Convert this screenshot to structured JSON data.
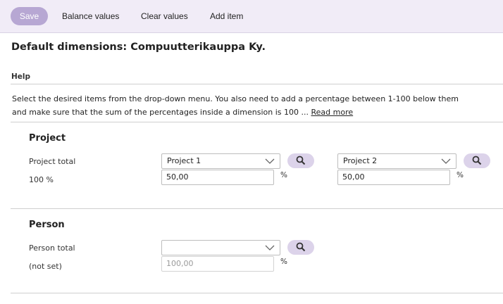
{
  "toolbar": {
    "save_label": "Save",
    "balance_label": "Balance values",
    "clear_label": "Clear values",
    "add_label": "Add item"
  },
  "page": {
    "title": "Default dimensions: Compuutterikauppa Ky."
  },
  "help": {
    "label": "Help",
    "text": "Select the desired items from the drop-down menu. You also need to add a percentage between 1-100 below them and make sure that the sum of the percentages inside a dimension is 100 ...",
    "read_more": "Read more"
  },
  "sections": {
    "project": {
      "title": "Project",
      "total_label": "Project total",
      "total_value": "100 %",
      "items": [
        {
          "select": "Project 1",
          "value": "50,00",
          "unit": "%"
        },
        {
          "select": "Project 2",
          "value": "50,00",
          "unit": "%"
        }
      ]
    },
    "person": {
      "title": "Person",
      "total_label": "Person total",
      "total_value": "(not set)",
      "items": [
        {
          "select": "",
          "placeholder": "100,00",
          "unit": "%"
        }
      ]
    }
  },
  "icons": {
    "search": "search-icon",
    "chevron": "chevron-down-icon"
  },
  "colors": {
    "toolbar_bg": "#f1ecf7",
    "save_bg": "#b7a7d3",
    "search_bg": "#dcd3ea"
  }
}
